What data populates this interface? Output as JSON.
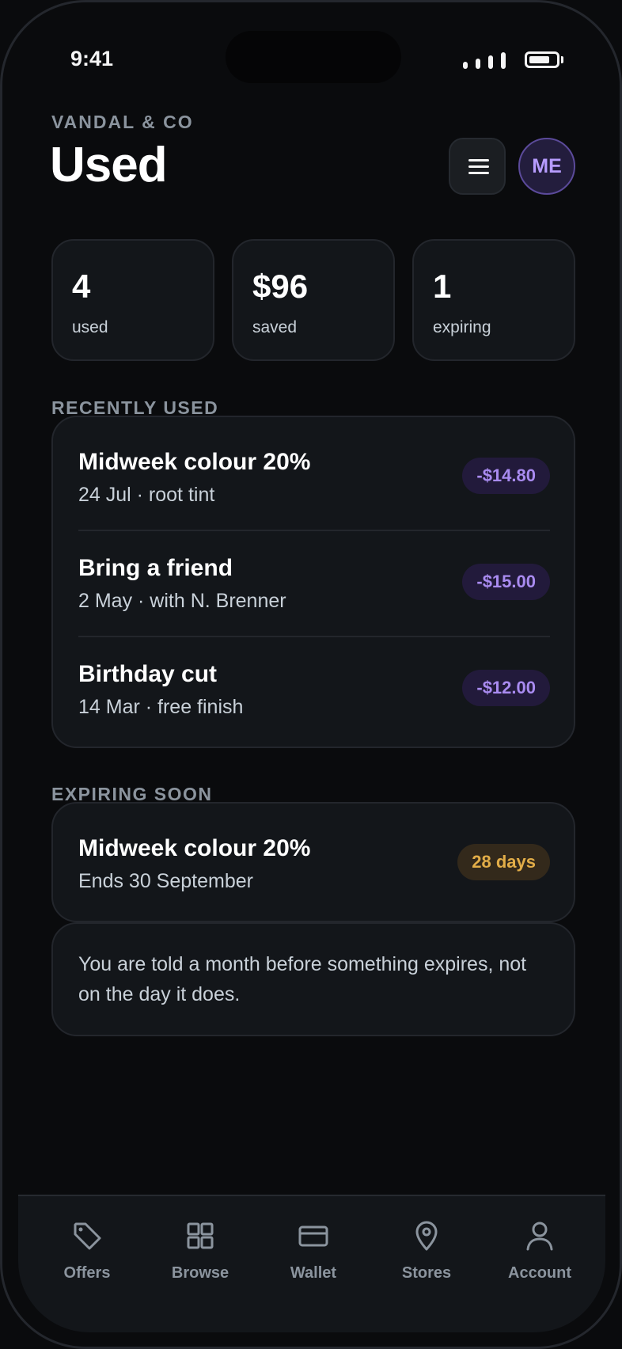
{
  "status_bar": {
    "time": "9:41"
  },
  "header": {
    "brand": "VANDAL & CO",
    "title": "Used",
    "avatar_initials": "ME"
  },
  "stats": [
    {
      "value": "4",
      "label": "used"
    },
    {
      "value": "$96",
      "label": "saved"
    },
    {
      "value": "1",
      "label": "expiring"
    }
  ],
  "recently_used": {
    "label": "RECENTLY USED",
    "items": [
      {
        "title": "Midweek colour 20%",
        "subtitle": "24 Jul · root tint",
        "amount": "-$14.80"
      },
      {
        "title": "Bring a friend",
        "subtitle": "2 May · with N. Brenner",
        "amount": "-$15.00"
      },
      {
        "title": "Birthday cut",
        "subtitle": "14 Mar · free finish",
        "amount": "-$12.00"
      }
    ]
  },
  "expiring_soon": {
    "label": "EXPIRING SOON",
    "item": {
      "title": "Midweek colour 20%",
      "subtitle": "Ends 30 September",
      "badge": "28 days"
    },
    "note": "You are told a month before something expires, not on the day it does."
  },
  "tabbar": {
    "tabs": [
      {
        "label": "Offers",
        "icon": "tag-icon"
      },
      {
        "label": "Browse",
        "icon": "grid-icon"
      },
      {
        "label": "Wallet",
        "icon": "wallet-icon"
      },
      {
        "label": "Stores",
        "icon": "location-pin-icon"
      },
      {
        "label": "Account",
        "icon": "person-icon"
      }
    ]
  },
  "colors": {
    "background": "#0a0b0d",
    "card": "#13161a",
    "accent_purple": "#a98bf0",
    "accent_amber": "#e2ad48",
    "muted_text": "#8b949e"
  }
}
